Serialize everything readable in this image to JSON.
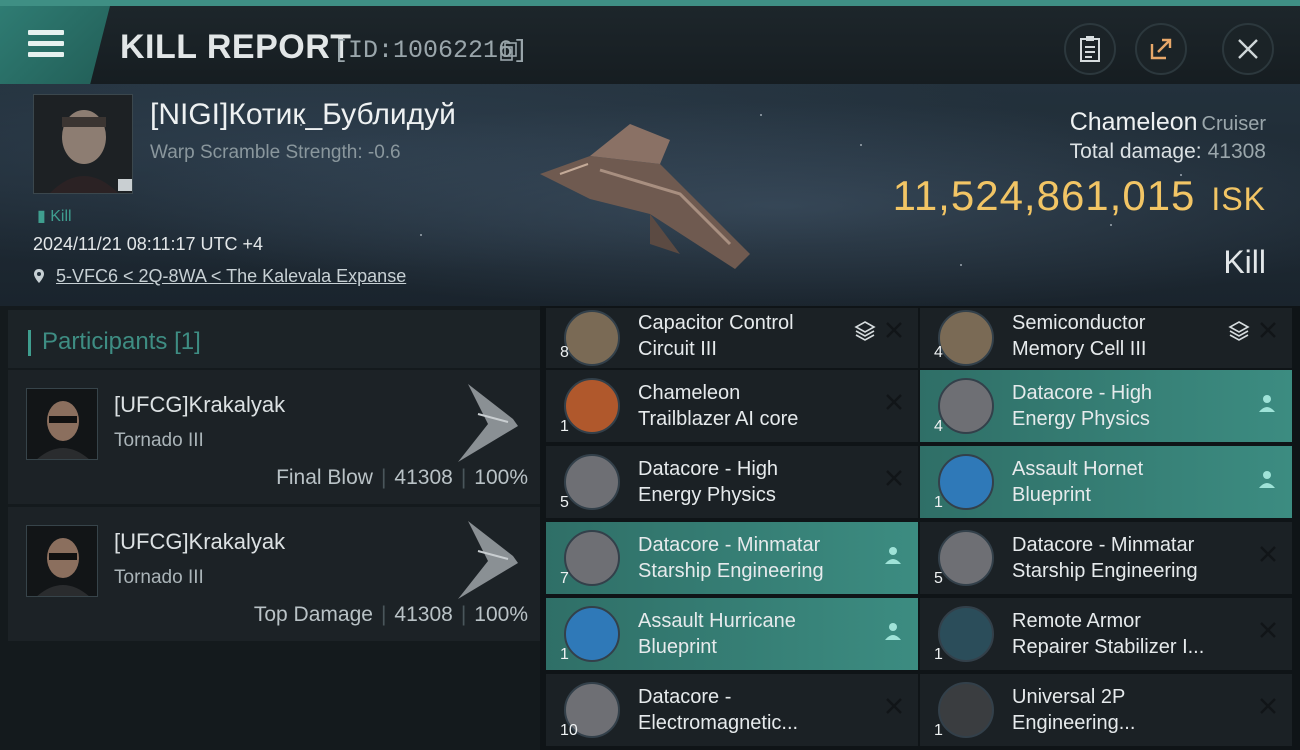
{
  "header": {
    "title": "KILL REPORT",
    "id_text": "[ID:10062216]"
  },
  "victim": {
    "name": "[NIGI]Котик_Бублидуй",
    "warp_scramble": "Warp Scramble Strength: -0.6",
    "tag": "Kill",
    "time": "2024/11/21 08:11:17 UTC +4",
    "location": "5-VFC6 < 2Q-8WA < The Kalevala Expanse",
    "ship_name": "Chameleon",
    "ship_class": "Cruiser",
    "total_damage_label": "Total damage:",
    "total_damage": "41308",
    "isk_value": "11,524,861,015",
    "isk_unit": "ISK",
    "kill_type": "Kill"
  },
  "participants": {
    "title": "Participants",
    "count": "[1]",
    "cards": [
      {
        "name": "[UFCG]Krakalyak",
        "ship": "Tornado III",
        "role": "Final Blow",
        "damage": "41308",
        "percent": "100%"
      },
      {
        "name": "[UFCG]Krakalyak",
        "ship": "Tornado III",
        "role": "Top Damage",
        "damage": "41308",
        "percent": "100%"
      }
    ]
  },
  "items": [
    {
      "qty": "8",
      "line1": "Capacitor Control",
      "line2": "Circuit III",
      "icon": "rig-icon",
      "highlight": false,
      "stack": true
    },
    {
      "qty": "4",
      "line1": "Semiconductor",
      "line2": "Memory Cell III",
      "icon": "rig-icon",
      "highlight": false,
      "stack": true
    },
    {
      "qty": "1",
      "line1": "Chameleon",
      "line2": "Trailblazer AI core",
      "icon": "ai-core-icon",
      "highlight": false,
      "stack": false
    },
    {
      "qty": "4",
      "line1": "Datacore - High",
      "line2": "Energy Physics",
      "icon": "datacore-icon",
      "highlight": true,
      "stack": false
    },
    {
      "qty": "5",
      "line1": "Datacore - High",
      "line2": "Energy Physics",
      "icon": "datacore-icon",
      "highlight": false,
      "stack": false
    },
    {
      "qty": "1",
      "line1": "Assault Hornet",
      "line2": "Blueprint",
      "icon": "blueprint-icon",
      "highlight": true,
      "stack": false
    },
    {
      "qty": "7",
      "line1": "Datacore - Minmatar",
      "line2": "Starship Engineering",
      "icon": "datacore-icon",
      "highlight": true,
      "stack": false
    },
    {
      "qty": "5",
      "line1": "Datacore - Minmatar",
      "line2": "Starship Engineering",
      "icon": "datacore-icon",
      "highlight": false,
      "stack": false
    },
    {
      "qty": "1",
      "line1": "Assault Hurricane",
      "line2": "Blueprint",
      "icon": "blueprint-icon",
      "highlight": true,
      "stack": false
    },
    {
      "qty": "1",
      "line1": "Remote Armor",
      "line2": "Repairer Stabilizer I...",
      "icon": "module-icon",
      "highlight": false,
      "stack": false
    },
    {
      "qty": "10",
      "line1": "Datacore -",
      "line2": "Electromagnetic...",
      "icon": "datacore-icon",
      "highlight": false,
      "stack": false
    },
    {
      "qty": "1",
      "line1": "Universal 2P",
      "line2": "Engineering...",
      "icon": "component-icon",
      "highlight": false,
      "stack": false
    }
  ]
}
